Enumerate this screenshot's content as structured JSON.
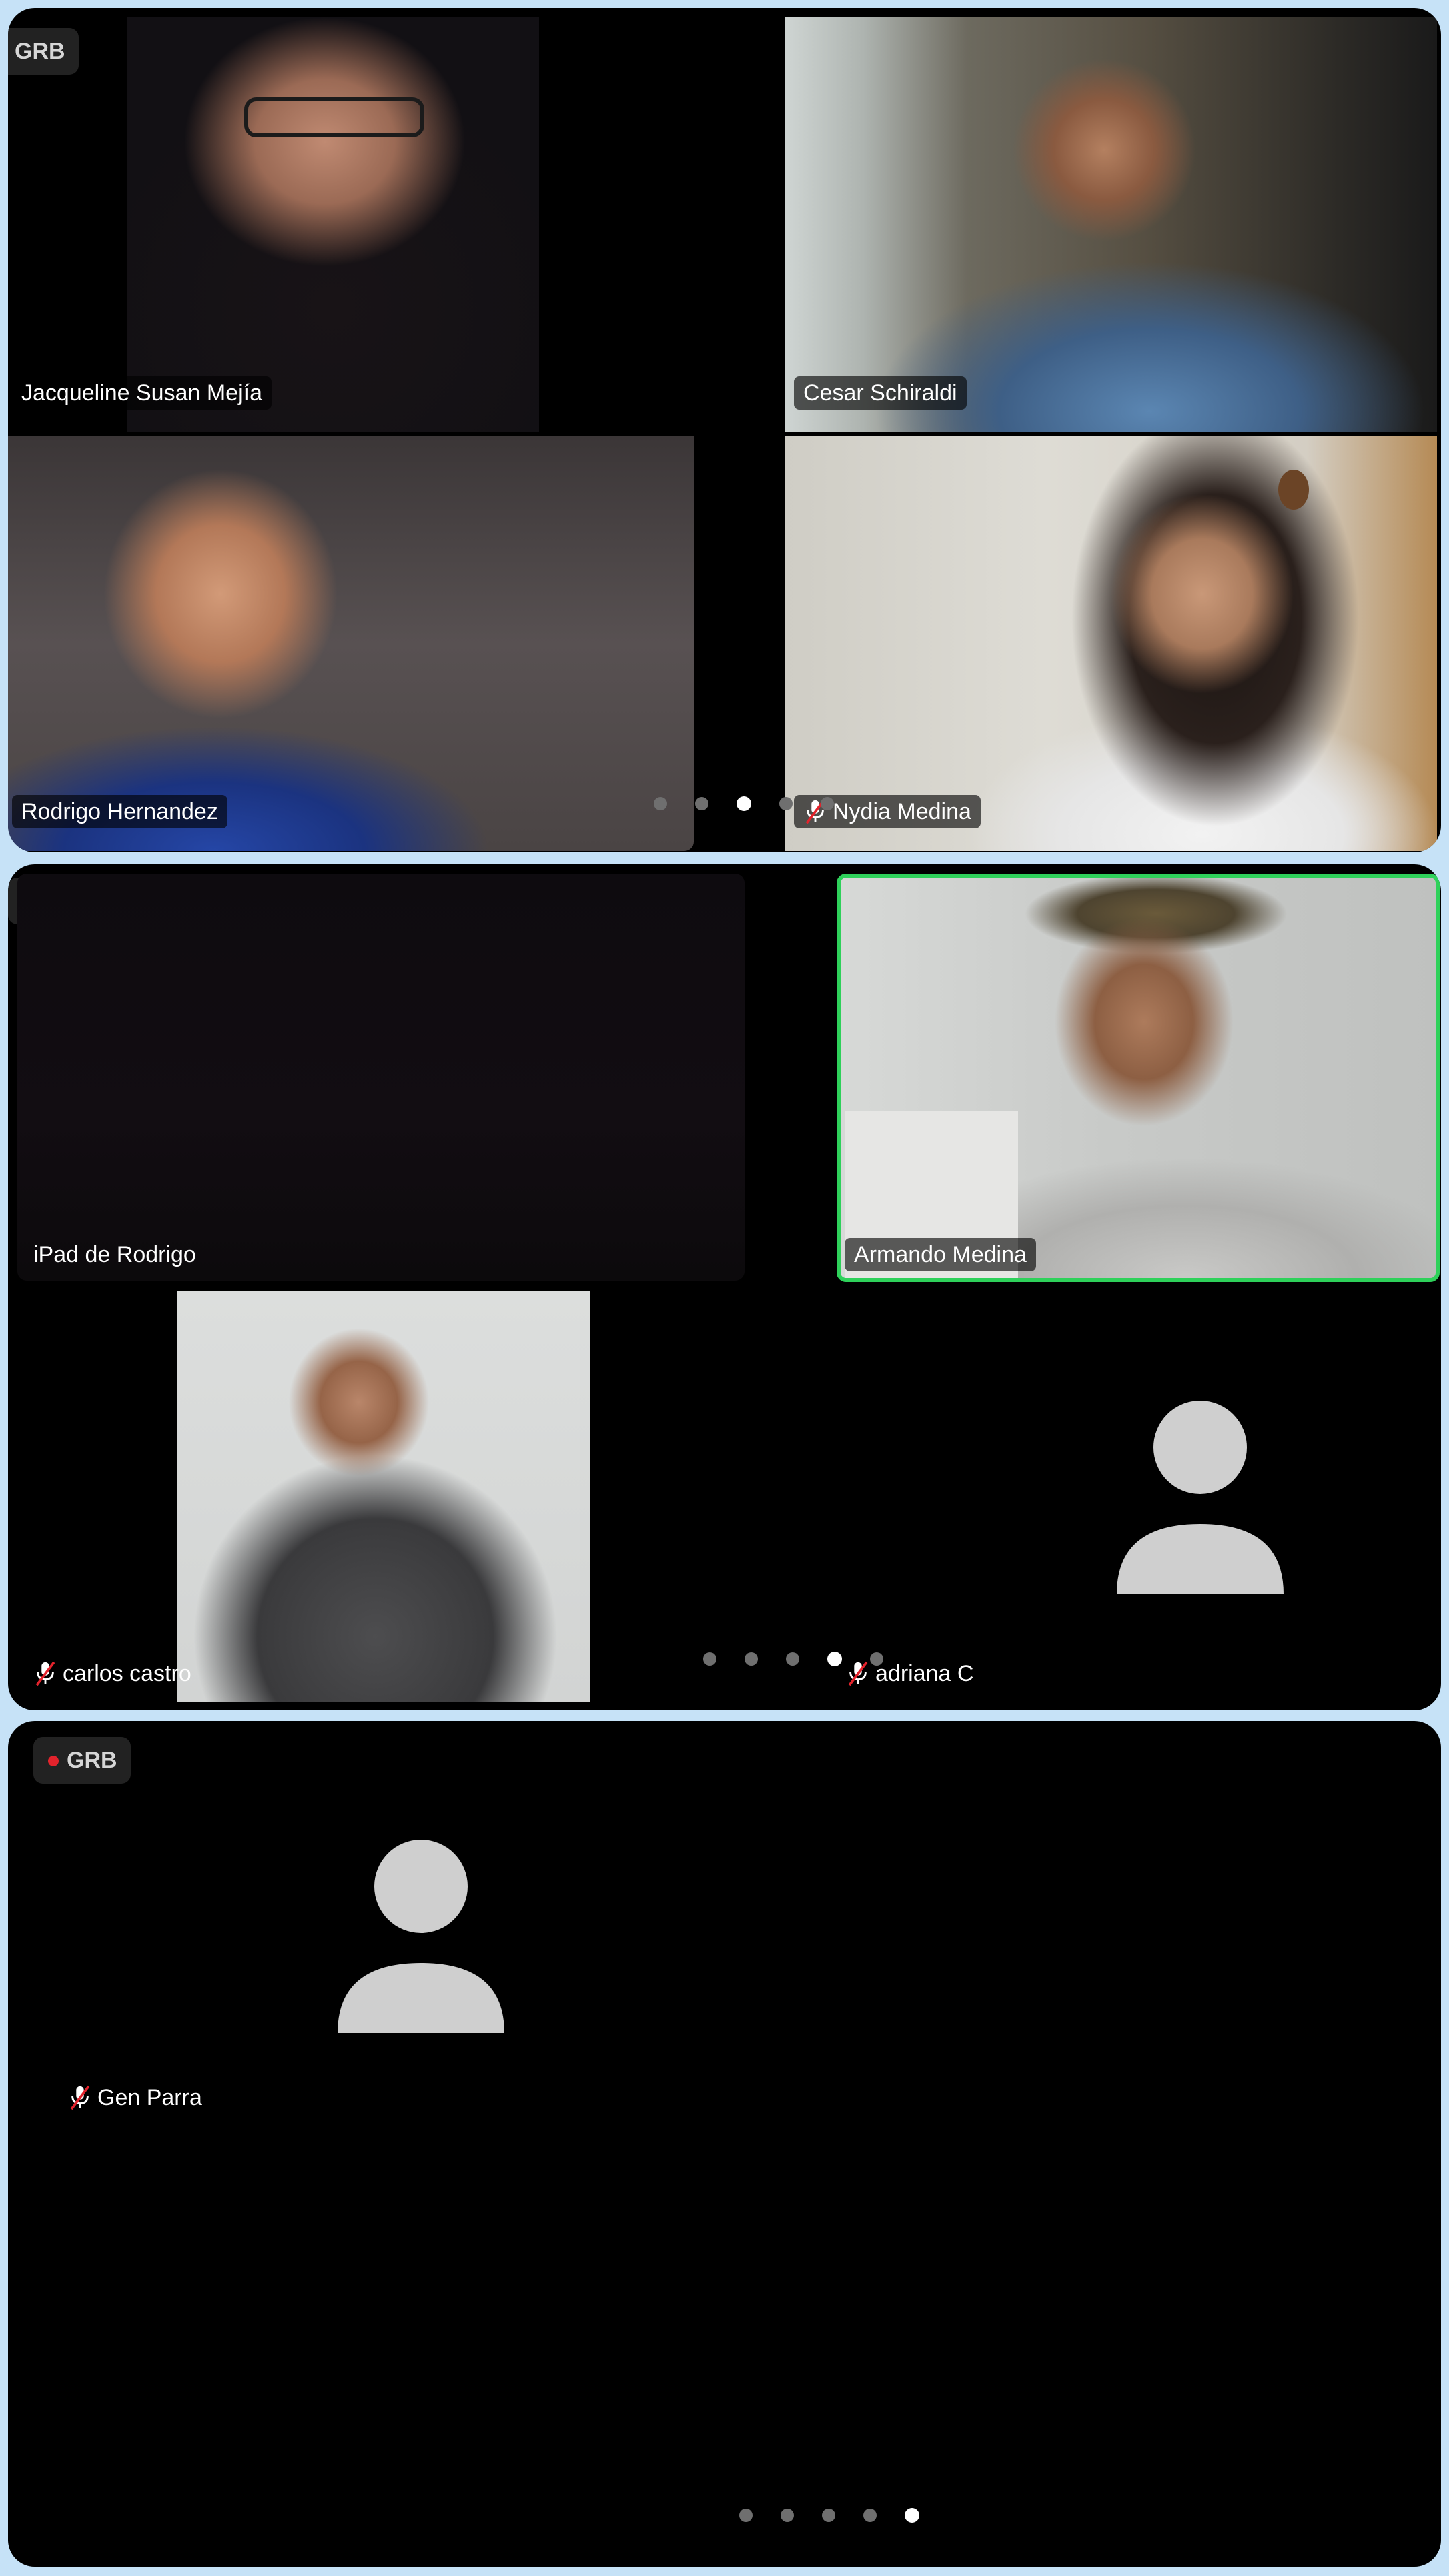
{
  "recording_label": "GRB",
  "participants": {
    "p1": "Jacqueline Susan Mejía",
    "p2": "Cesar Schiraldi",
    "p3": "Rodrigo Hernandez",
    "p4": "Nydia Medina",
    "p5": "iPad de Rodrigo",
    "p6": "Armando Medina",
    "p7": "carlos castro",
    "p8": "adriana C",
    "p9": "Gen Parra"
  },
  "pages": {
    "panel1": {
      "total": 5,
      "active": 3
    },
    "panel2": {
      "total": 5,
      "active": 4
    },
    "panel3": {
      "total": 5,
      "active": 5
    }
  },
  "colors": {
    "background": "#c6e2f7",
    "panel": "#000000",
    "active_speaker_border": "#2ed15a",
    "recording_dot": "#e3232c"
  },
  "icons": [
    "muted-mic-icon",
    "person-avatar-icon",
    "recording-dot-icon"
  ]
}
